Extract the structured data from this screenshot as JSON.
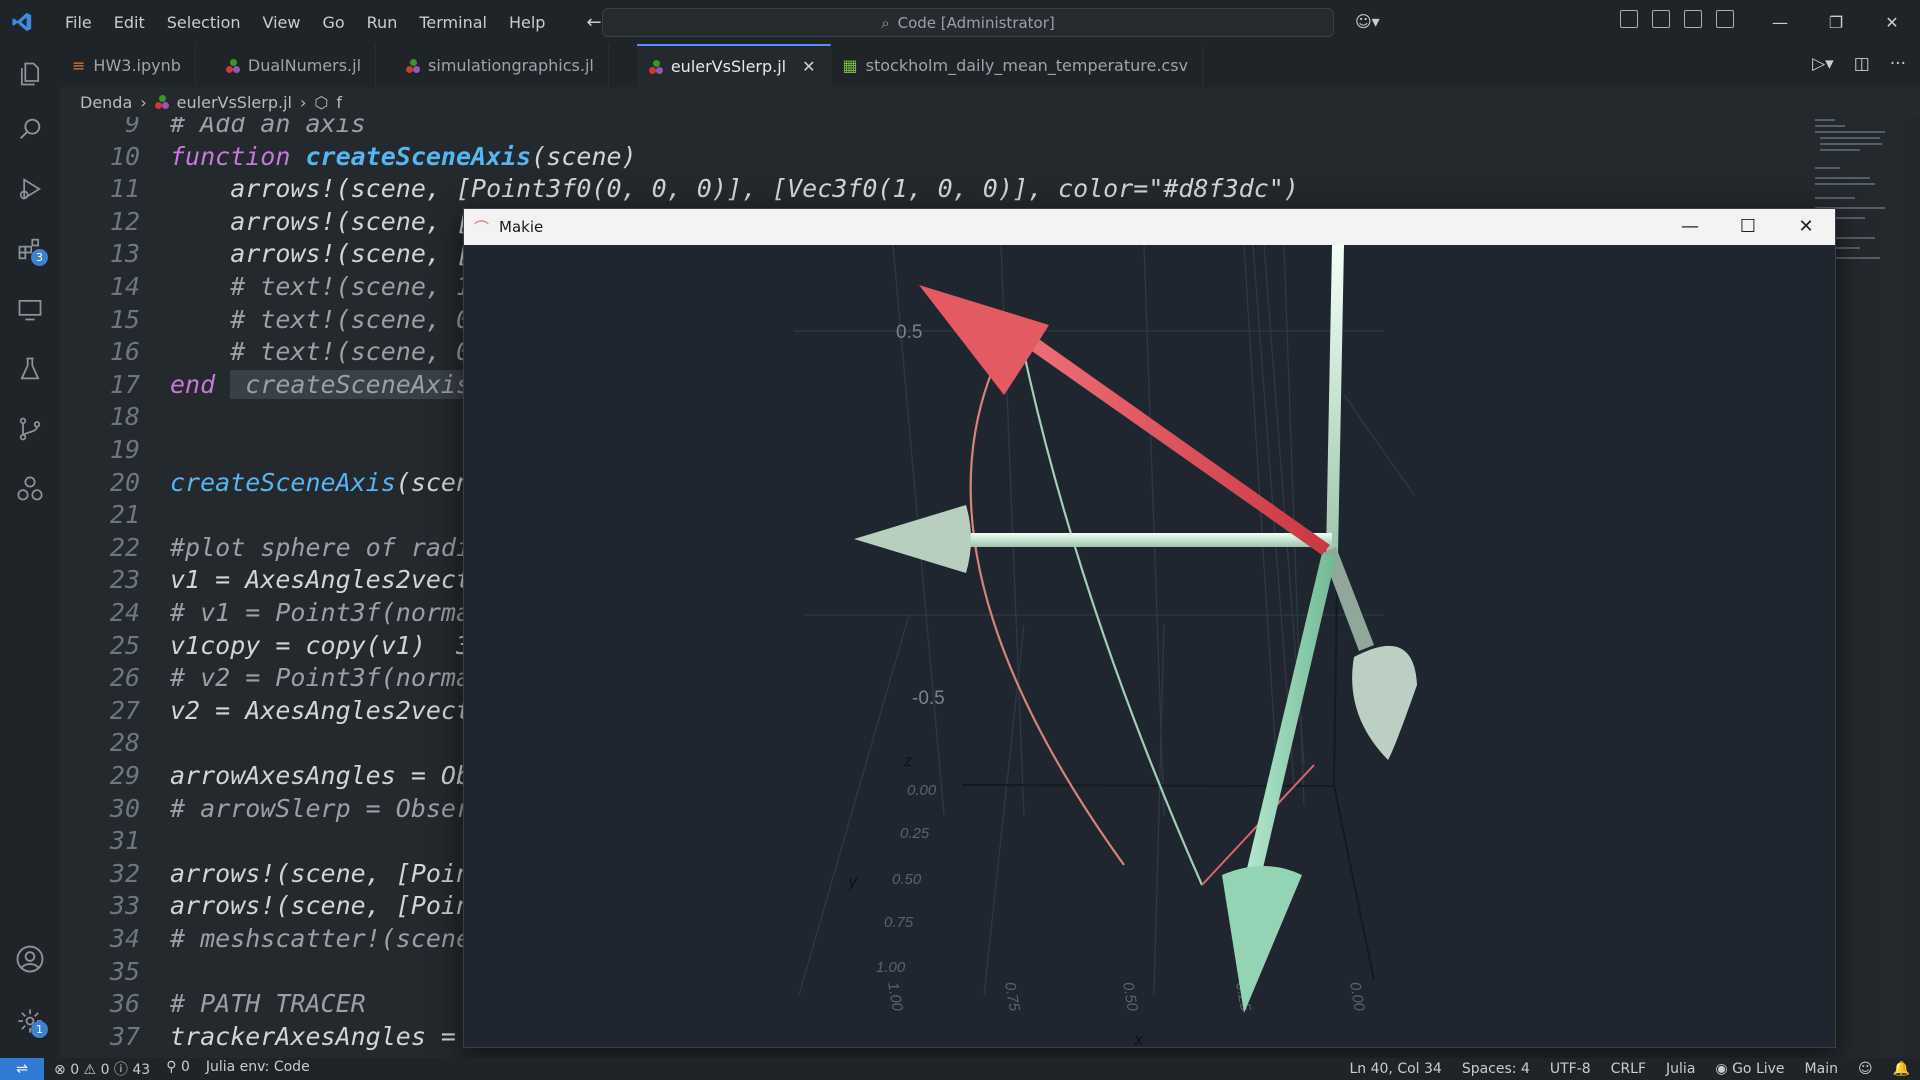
{
  "menu": [
    "File",
    "Edit",
    "Selection",
    "View",
    "Go",
    "Run",
    "Terminal",
    "Help"
  ],
  "command_center": "Code [Administrator]",
  "tabs": [
    {
      "label": "HW3.ipynb"
    },
    {
      "label": "DualNumers.jl"
    },
    {
      "label": "simulationgraphics.jl"
    },
    {
      "label": "eulerVsSlerp.jl",
      "active": true
    },
    {
      "label": "stockholm_daily_mean_temperature.csv"
    }
  ],
  "breadcrumb": {
    "folder": "Denda",
    "file": "eulerVsSlerp.jl",
    "symbol": "f"
  },
  "activity_badges": {
    "extensions": "3",
    "settings": "1"
  },
  "code_lines": [
    {
      "n": "9",
      "text": "# Add an axis"
    },
    {
      "n": "10",
      "kw": "function ",
      "fn": "createSceneAxis",
      "rest": "(scene)"
    },
    {
      "n": "11",
      "text": "    arrows!(scene, [Point3f0(0, 0, 0)], [Vec3f0(1, 0, 0)], color=\"#d8f3dc\")"
    },
    {
      "n": "12",
      "text": "    arrows!(scene, ["
    },
    {
      "n": "13",
      "text": "    arrows!(scene, ["
    },
    {
      "n": "14",
      "text": "    # text!(scene, 1"
    },
    {
      "n": "15",
      "text": "    # text!(scene, 0"
    },
    {
      "n": "16",
      "text": "    # text!(scene, 0"
    },
    {
      "n": "17",
      "kw": "end ",
      "rest": " createSceneAxis"
    },
    {
      "n": "18",
      "text": ""
    },
    {
      "n": "19",
      "text": ""
    },
    {
      "n": "20",
      "fn2": "createSceneAxis",
      "rest": "(scen"
    },
    {
      "n": "21",
      "text": ""
    },
    {
      "n": "22",
      "text": "#plot sphere of radi"
    },
    {
      "n": "23",
      "text": "v1 = AxesAngles2vect"
    },
    {
      "n": "24",
      "text": "# v1 = Point3f(norma"
    },
    {
      "n": "25",
      "text": "v1copy = copy(v1)  3"
    },
    {
      "n": "26",
      "text": "# v2 = Point3f(norma"
    },
    {
      "n": "27",
      "text": "v2 = AxesAngles2vect"
    },
    {
      "n": "28",
      "text": ""
    },
    {
      "n": "29",
      "text": "arrowAxesAngles = Ob"
    },
    {
      "n": "30",
      "text": "# arrowSlerp = Obser"
    },
    {
      "n": "31",
      "text": ""
    },
    {
      "n": "32",
      "text": "arrows!(scene, [Poin"
    },
    {
      "n": "33",
      "text": "arrows!(scene, [Poin"
    },
    {
      "n": "34",
      "text": "# meshscatter!(scene"
    },
    {
      "n": "35",
      "text": ""
    },
    {
      "n": "36",
      "text": "# PATH TRACER"
    },
    {
      "n": "37",
      "text": "trackerAxesAngles ="
    }
  ],
  "makie": {
    "title": "Makie",
    "axis_labels": {
      "z": "z",
      "y": "y",
      "x": "x"
    },
    "z_ticks": [
      "0.5",
      "-0.5"
    ],
    "y_ticks": [
      "0.00",
      "0.25",
      "0.50",
      "0.75",
      "1.00"
    ],
    "x_ticks": [
      "1.00",
      "0.75",
      "0.50",
      "0.25",
      "0.00"
    ]
  },
  "status": {
    "errors": "0",
    "warnings": "0",
    "infos": "43",
    "ports": "0",
    "julia_env": "Julia env: Code",
    "position": "Ln 40, Col 34",
    "spaces": "Spaces: 4",
    "encoding": "UTF-8",
    "eol": "CRLF",
    "language": "Julia",
    "golive": "Go Live",
    "branch": "Main"
  },
  "colors": {
    "accent": "#3b82d6",
    "red_arrow": "#e0525c",
    "green_arrow": "#a8dcc4"
  }
}
